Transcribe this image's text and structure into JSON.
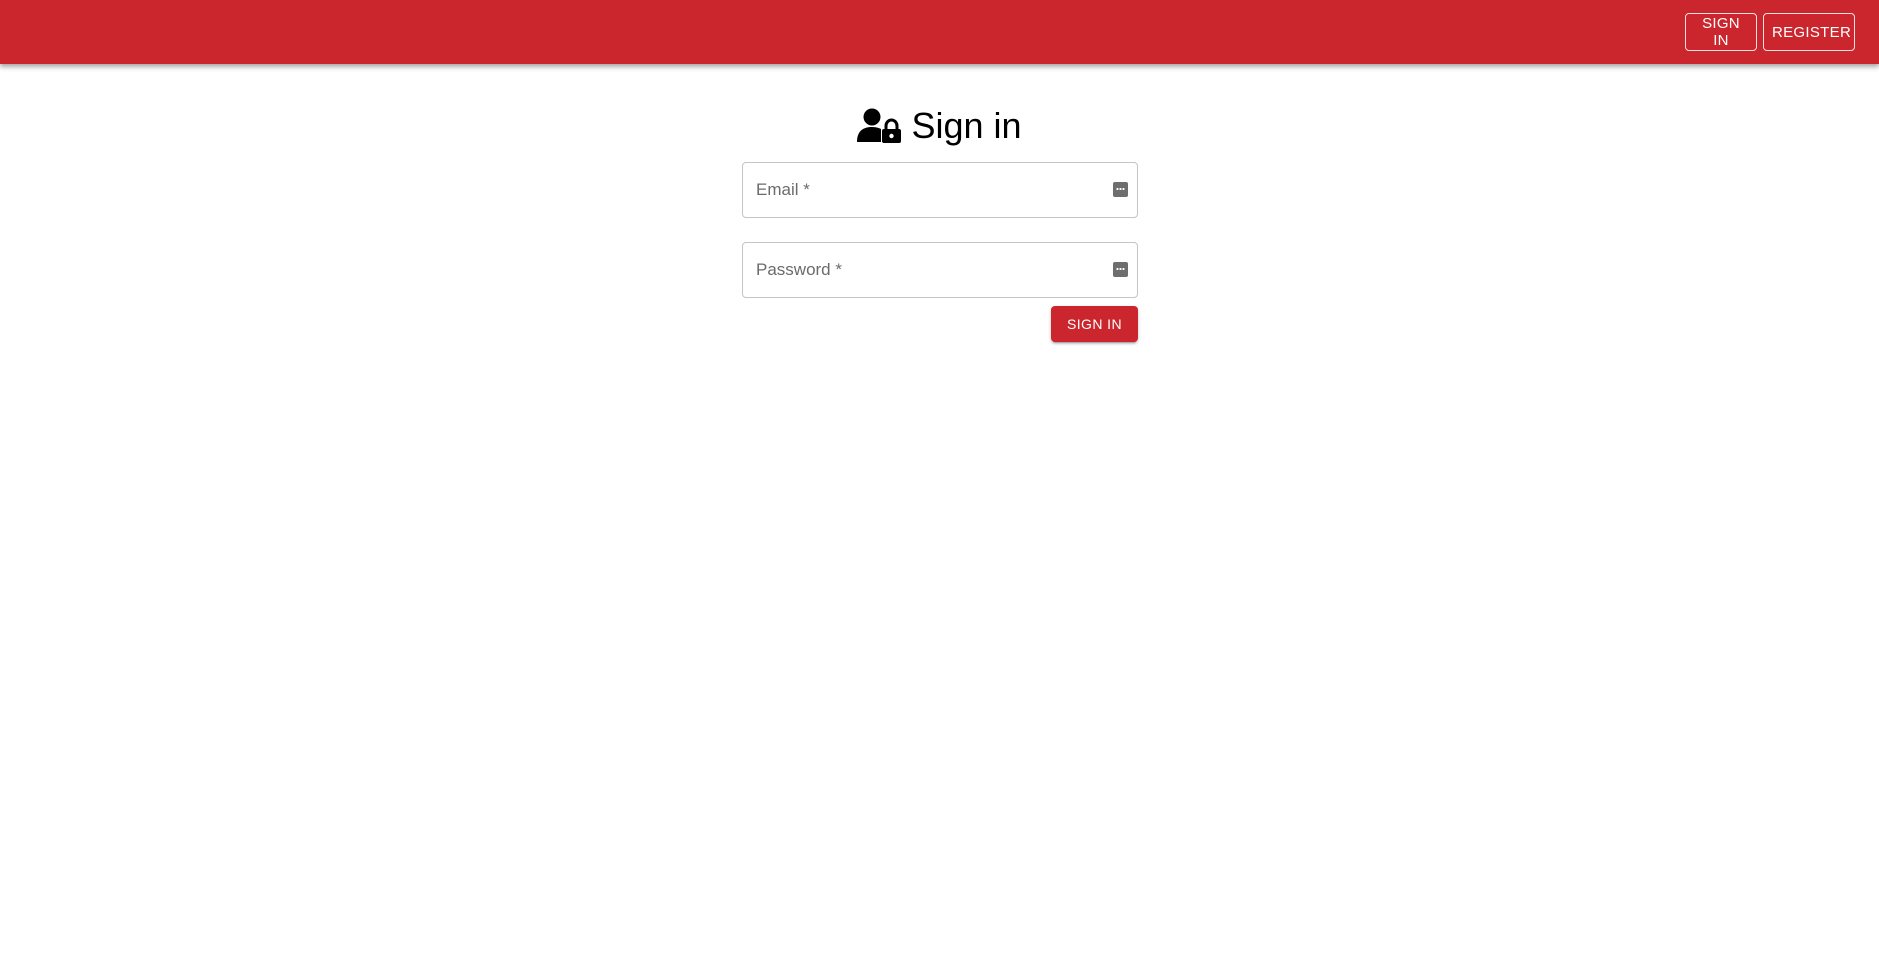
{
  "appbar": {
    "color": "#cb262d",
    "signin_label": "SIGN IN",
    "register_label": "REGISTER"
  },
  "page": {
    "title": "Sign in",
    "title_icon": "user-lock-icon"
  },
  "form": {
    "email": {
      "value": "",
      "placeholder": "Email *",
      "icon": "autofill-dots-icon"
    },
    "password": {
      "value": "",
      "placeholder": "Password *",
      "icon": "autofill-dots-icon"
    },
    "submit_label": "SIGN IN"
  }
}
